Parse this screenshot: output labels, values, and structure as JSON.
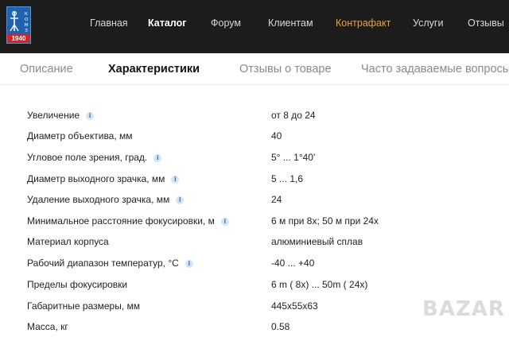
{
  "header": {
    "logo_year": "1940",
    "nav": [
      {
        "label": "Главная"
      },
      {
        "label": "Каталог"
      },
      {
        "label": "Форум"
      },
      {
        "label": "Клиентам"
      },
      {
        "label": "Контрафакт"
      },
      {
        "label": "Услуги"
      },
      {
        "label": "Отзывы"
      }
    ],
    "nav_active_index": 1,
    "colors": {
      "bar": "#1c1c1c",
      "accent": "#e8a23a",
      "logo": "#1f63b0",
      "logo_year": "#c8282e"
    }
  },
  "tabs": [
    {
      "label": "Описание"
    },
    {
      "label": "Характеристики"
    },
    {
      "label": "Отзывы о товаре"
    },
    {
      "label": "Часто задаваемые вопросы"
    }
  ],
  "active_tab": 1,
  "specs": [
    {
      "label": "Увеличение",
      "value": "от 8 до 24",
      "info": true
    },
    {
      "label": "Диаметр объектива, мм",
      "value": "40",
      "info": false
    },
    {
      "label": "Угловое поле зрения, град.",
      "value": "5° ... 1°40'",
      "info": true
    },
    {
      "label": "Диаметр выходного зрачка, мм",
      "value": "5 ... 1,6",
      "info": true
    },
    {
      "label": "Удаление выходного зрачка, мм",
      "value": "24",
      "info": true
    },
    {
      "label": "Минимальное расстояние фокусировки, м",
      "value": "6 м при 8х; 50 м при 24х",
      "info": true
    },
    {
      "label": "Материал корпуса",
      "value": "алюминиевый сплав",
      "info": false
    },
    {
      "label": "Рабочий диапазон температур, °С",
      "value": "-40 ... +40",
      "info": true
    },
    {
      "label": "Пределы фокусировки",
      "value": "6 m ( 8x) ... 50m ( 24x)",
      "info": false
    },
    {
      "label": "Габаритные размеры, мм",
      "value": "445x55x63",
      "info": false
    },
    {
      "label": "Масса, кг",
      "value": "0.58",
      "info": false
    }
  ],
  "info_icon_glyph": "i",
  "watermark": "BAZAR"
}
